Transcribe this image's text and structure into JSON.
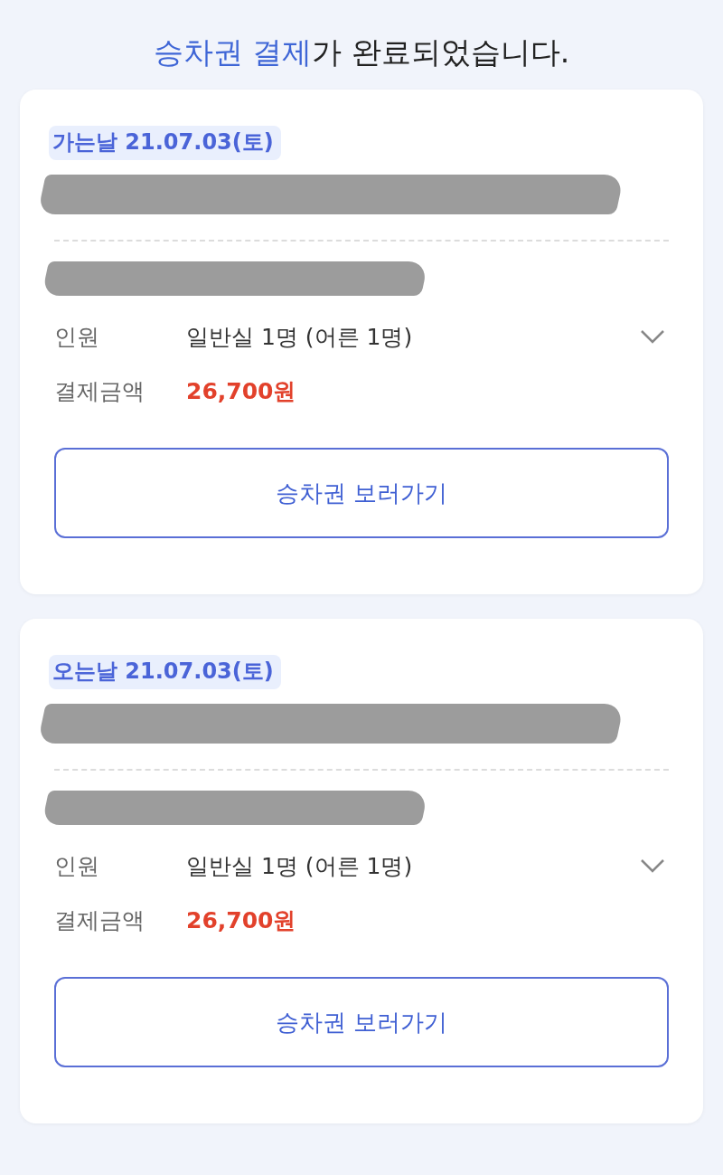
{
  "title": [
    {
      "text": "승차권 결제",
      "kind": "accent"
    },
    {
      "text": "가 완료되었습니다.",
      "kind": "plain"
    }
  ],
  "tickets": [
    {
      "date": "가는날 21.07.03(토)",
      "details": [
        {
          "label": "인원",
          "value": "일반실 1명 (어른 1명)",
          "kind": "expandable"
        },
        {
          "label": "결제금액",
          "value": "26,700원",
          "kind": "price"
        }
      ],
      "button": "승차권 보러가기"
    },
    {
      "date": "오는날 21.07.03(토)",
      "details": [
        {
          "label": "인원",
          "value": "일반실 1명 (어른 1명)",
          "kind": "expandable"
        },
        {
          "label": "결제금액",
          "value": "26,700원",
          "kind": "price"
        }
      ],
      "button": "승차권 보러가기"
    }
  ]
}
